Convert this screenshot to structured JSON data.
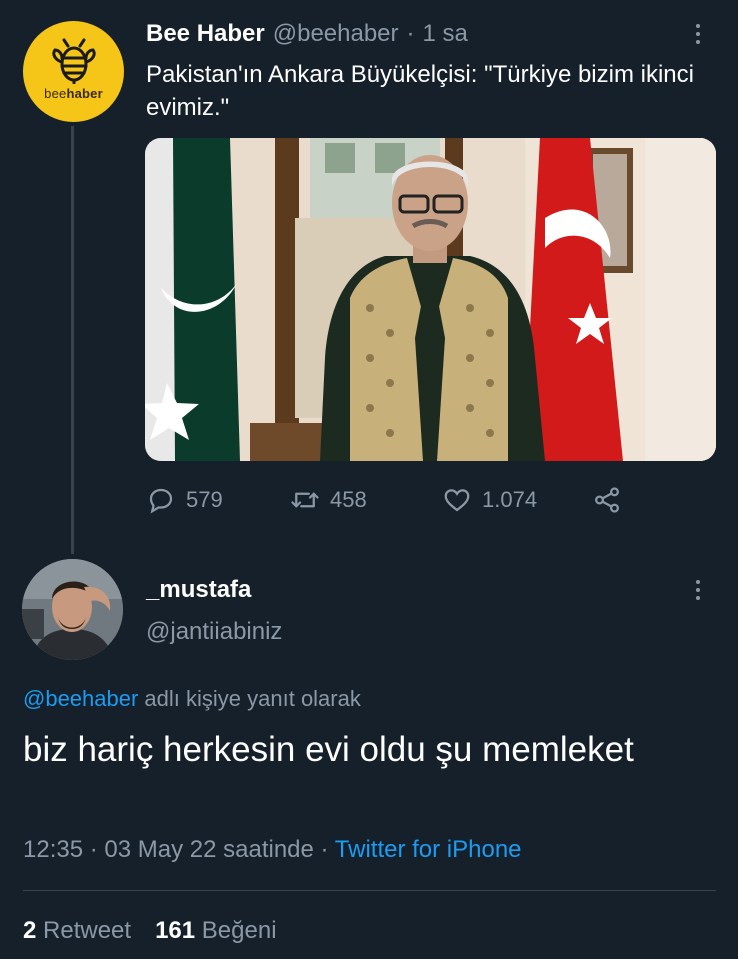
{
  "tweet1": {
    "name": "Bee Haber",
    "handle": "@beehaber",
    "separator": "·",
    "time": "1 sa",
    "text": "Pakistan'ın Ankara Büyükelçisi: \"Türkiye bizim ikinci evimiz.\"",
    "avatar_wordmark_a": "bee",
    "avatar_wordmark_b": "haber",
    "actions": {
      "replies": "579",
      "retweets": "458",
      "likes": "1.074"
    }
  },
  "tweet2": {
    "name": "_mustafa",
    "handle": "@jantiiabiniz",
    "reply_mention": "@beehaber",
    "reply_suffix": " adlı kişiye yanıt olarak",
    "text": "biz hariç herkesin evi oldu şu memleket",
    "time": "12:35",
    "sep1": " · ",
    "date": "03 May 22 saatinde",
    "sep2": " · ",
    "source": "Twitter for iPhone",
    "stats": {
      "retweets_count": "2",
      "retweets_label": "Retweet",
      "likes_count": "161",
      "likes_label": "Beğeni"
    }
  },
  "colors": {
    "background": "#15202b",
    "accent": "#1d9bf0",
    "muted": "#8b98a5",
    "bee_yellow": "#f5c518"
  },
  "icons": [
    "bee-logo-icon",
    "more-icon",
    "reply-icon",
    "retweet-icon",
    "like-icon",
    "share-icon"
  ]
}
